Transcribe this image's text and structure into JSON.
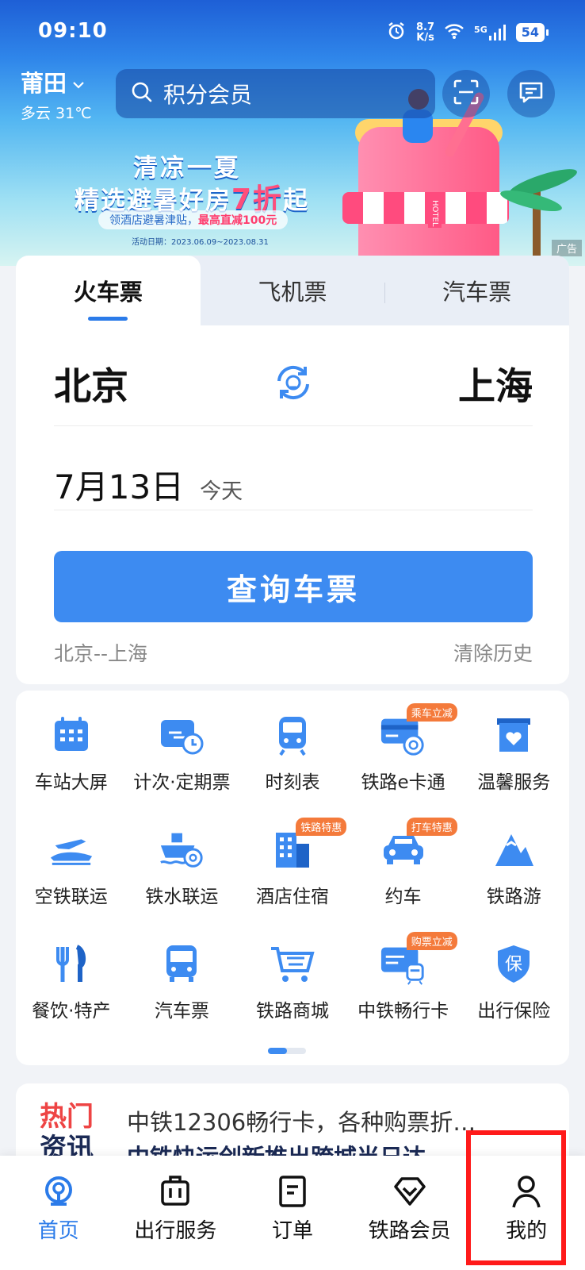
{
  "status": {
    "time": "09:10",
    "speed_value": "8.7",
    "speed_unit": "K/s",
    "network": "5G",
    "battery": "54"
  },
  "location": {
    "city": "莆田",
    "weather": "多云 31℃"
  },
  "search": {
    "placeholder": "积分会员"
  },
  "ad": {
    "title1": "清凉一夏",
    "title2_prefix": "精选避暑好房",
    "title2_highlight": "7折",
    "title2_suffix": "起",
    "subtitle_prefix": "领酒店避暑津贴，",
    "subtitle_highlight": "最高直减100元",
    "date": "活动日期：2023.06.09~2023.08.31",
    "tag": "广告",
    "hotel_sign": "HOTEL"
  },
  "ticket": {
    "tabs": [
      {
        "label": "火车票",
        "active": true
      },
      {
        "label": "飞机票",
        "active": false
      },
      {
        "label": "汽车票",
        "active": false
      }
    ],
    "from": "北京",
    "to": "上海",
    "date": "7月13日",
    "date_hint": "今天",
    "query_button": "查询车票",
    "history": "北京--上海",
    "clear_history": "清除历史"
  },
  "services": [
    {
      "label": "车站大屏",
      "icon": "calendar-screen-icon"
    },
    {
      "label": "计次·定期票",
      "icon": "ticket-clock-icon"
    },
    {
      "label": "时刻表",
      "icon": "train-icon"
    },
    {
      "label": "铁路e卡通",
      "icon": "railcard-icon",
      "badge": "乘车立减"
    },
    {
      "label": "温馨服务",
      "icon": "heart-box-icon"
    },
    {
      "label": "空铁联运",
      "icon": "plane-train-icon"
    },
    {
      "label": "铁水联运",
      "icon": "ship-train-icon"
    },
    {
      "label": "酒店住宿",
      "icon": "hotel-icon",
      "badge": "铁路特惠"
    },
    {
      "label": "约车",
      "icon": "car-icon",
      "badge": "打车特惠"
    },
    {
      "label": "铁路游",
      "icon": "mountain-icon"
    },
    {
      "label": "餐饮·特产",
      "icon": "fork-knife-icon"
    },
    {
      "label": "汽车票",
      "icon": "bus-icon"
    },
    {
      "label": "铁路商城",
      "icon": "cart-icon"
    },
    {
      "label": "中铁畅行卡",
      "icon": "card-train-icon",
      "badge": "购票立减"
    },
    {
      "label": "出行保险",
      "icon": "shield-bao-icon"
    }
  ],
  "news": {
    "hot_line1": "热门",
    "hot_line2": "资讯",
    "items": [
      "中铁12306畅行卡，各种购票折…",
      "中铁快运创新推出跨城当日达"
    ]
  },
  "shield_char": "保",
  "tabbar": [
    {
      "label": "首页",
      "icon": "home-rail-icon",
      "active": true
    },
    {
      "label": "出行服务",
      "icon": "luggage-icon",
      "active": false
    },
    {
      "label": "订单",
      "icon": "order-icon",
      "active": false
    },
    {
      "label": "铁路会员",
      "icon": "diamond-icon",
      "active": false
    },
    {
      "label": "我的",
      "icon": "user-icon",
      "active": false
    }
  ],
  "colors": {
    "accent": "#3d8bf1",
    "badge": "#f47a3b",
    "highlight_box": "#ff1a1a"
  }
}
